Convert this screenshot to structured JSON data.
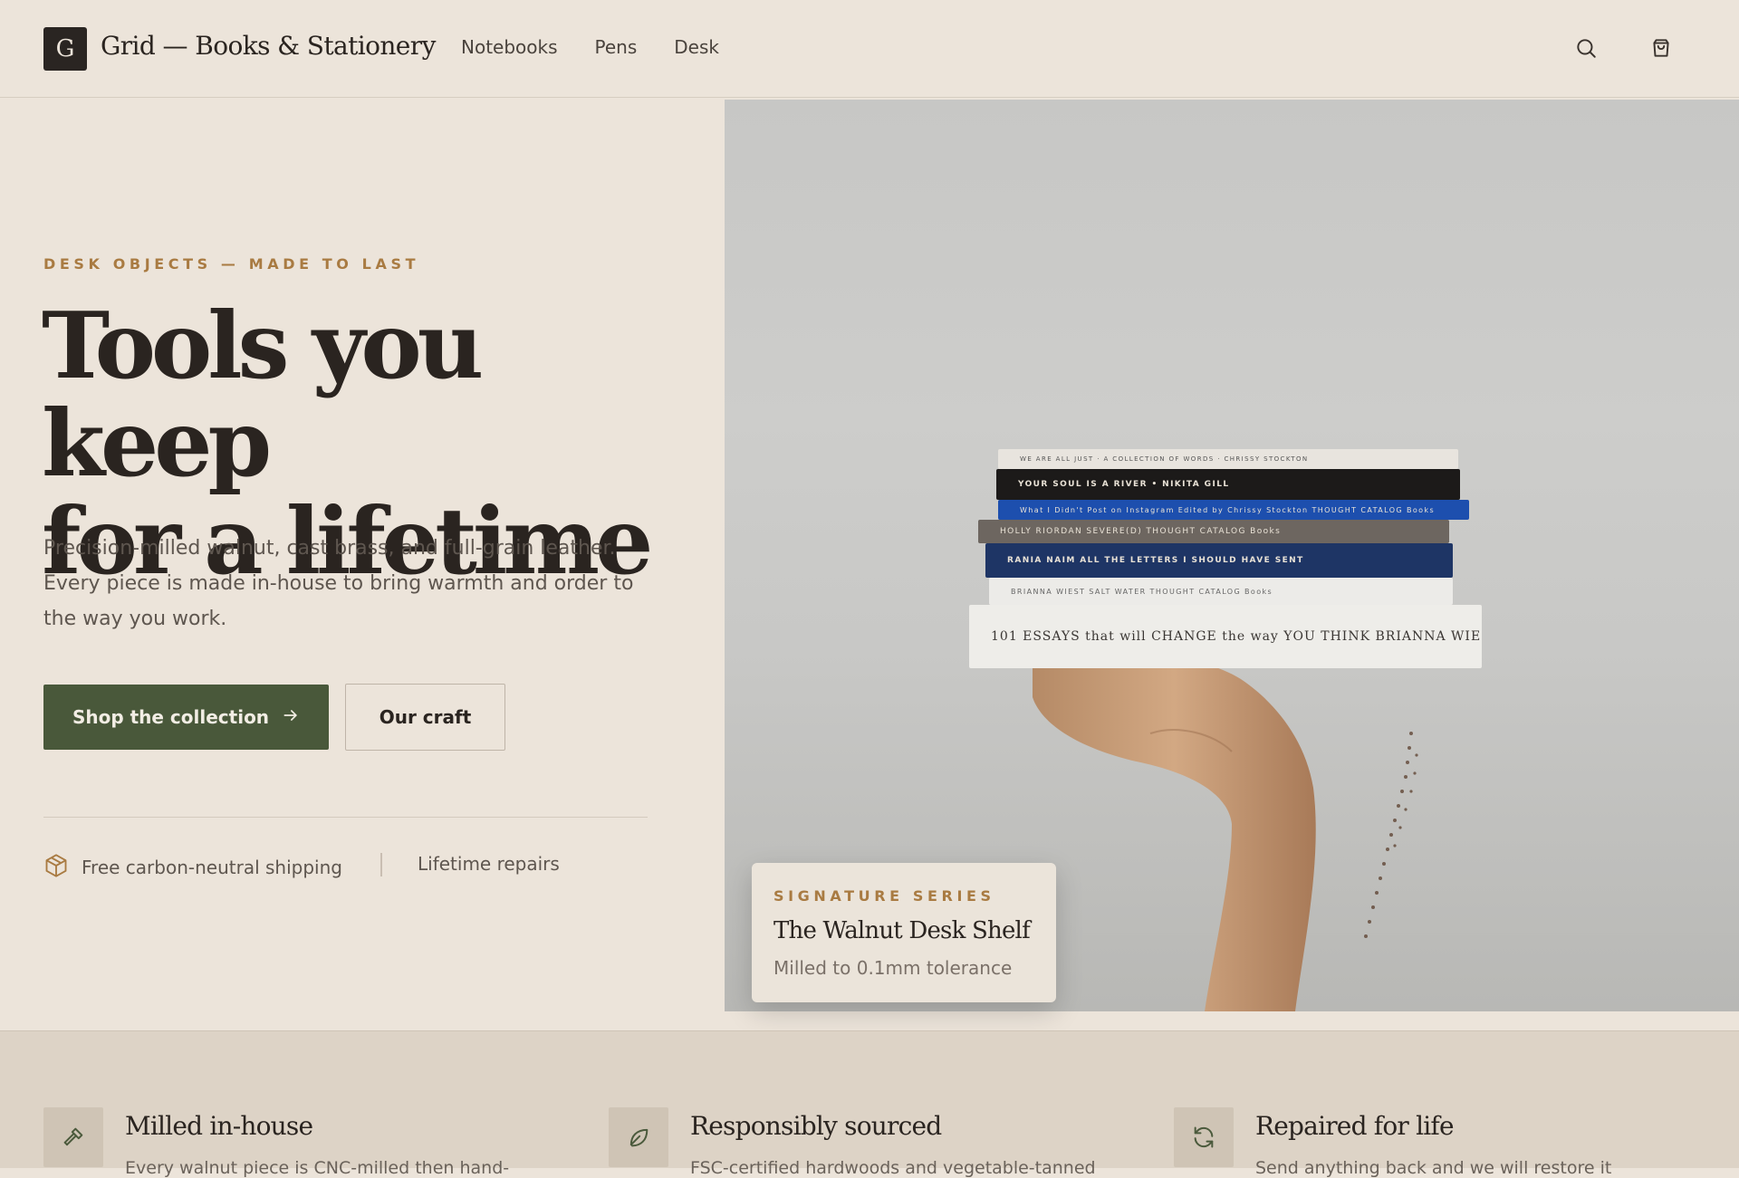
{
  "header": {
    "logo_letter": "G",
    "brand": "Grid — Books & Stationery",
    "nav": [
      {
        "label": "Notebooks"
      },
      {
        "label": "Pens"
      },
      {
        "label": "Desk"
      }
    ],
    "icons": [
      "search-icon",
      "cart-icon"
    ]
  },
  "hero": {
    "eyebrow": "DESK OBJECTS — MADE TO LAST",
    "headline_line1": "Tools you keep",
    "headline_line2": "for a lifetime",
    "subtext": "Precision-milled walnut, cast brass, and full-grain leather. Every piece is made in-house to bring warmth and order to the way you work.",
    "primary_button": "Shop the collection",
    "secondary_button": "Our craft",
    "perks": [
      "Free carbon-neutral shipping",
      "Lifetime repairs"
    ]
  },
  "image": {
    "books": [
      "WE ARE ALL JUST · A COLLECTION OF WORDS · CHRISSY STOCKTON",
      "YOUR SOUL IS A RIVER  •  NIKITA GILL",
      "What I Didn't Post on Instagram    Edited by Chrissy Stockton    THOUGHT CATALOG Books",
      "HOLLY RIORDAN    SEVERE(D)    THOUGHT CATALOG Books",
      "RANIA NAIM    ALL THE LETTERS I SHOULD HAVE SENT",
      "BRIANNA WIEST    SALT WATER    THOUGHT CATALOG Books",
      "101 ESSAYS that will CHANGE the way YOU THINK    BRIANNA WIEST"
    ],
    "card": {
      "eyebrow": "SIGNATURE SERIES",
      "title": "The Walnut Desk Shelf",
      "subtitle": "Milled to 0.1mm tolerance"
    }
  },
  "features": [
    {
      "icon": "hammer-icon",
      "title": "Milled in-house",
      "body": "Every walnut piece is CNC-milled then hand-"
    },
    {
      "icon": "leaf-icon",
      "title": "Responsibly sourced",
      "body": "FSC-certified hardwoods and vegetable-tanned"
    },
    {
      "icon": "refresh-icon",
      "title": "Repaired for life",
      "body": "Send anything back and we will restore it"
    }
  ],
  "colors": {
    "background": "#ece4da",
    "accent_gold": "#a97b42",
    "primary_green": "#49583a",
    "text_dark": "#2a2420"
  }
}
